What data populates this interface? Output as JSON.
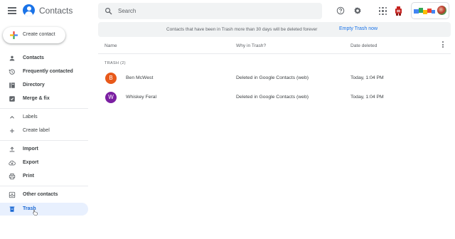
{
  "header": {
    "app_title": "Contacts",
    "search_placeholder": "Search",
    "icons": [
      "menu-icon",
      "contacts-logo-icon",
      "search-icon",
      "help-icon",
      "settings-icon",
      "apps-icon",
      "account-avatar"
    ]
  },
  "sidebar": {
    "create_label": "Create contact",
    "items": [
      {
        "label": "Contacts",
        "icon": "person-icon"
      },
      {
        "label": "Frequently contacted",
        "icon": "history-icon"
      },
      {
        "label": "Directory",
        "icon": "directory-icon"
      },
      {
        "label": "Merge & fix",
        "icon": "merge-icon"
      },
      {
        "label": "Labels",
        "icon": "chevron-up-icon"
      },
      {
        "label": "Create label",
        "icon": "plus-icon"
      },
      {
        "label": "Import",
        "icon": "upload-icon"
      },
      {
        "label": "Export",
        "icon": "cloud-download-icon"
      },
      {
        "label": "Print",
        "icon": "print-icon"
      },
      {
        "label": "Other contacts",
        "icon": "inbox-icon"
      },
      {
        "label": "Trash",
        "icon": "trash-icon",
        "active": true
      }
    ]
  },
  "banner": {
    "message": "Contacts that have been in Trash more than 30 days will be deleted forever",
    "action": "Empty Trash now"
  },
  "table": {
    "headers": [
      "Name",
      "Why in Trash?",
      "Date deleted"
    ],
    "section_label": "TRASH (2)",
    "rows": [
      {
        "initial": "B",
        "name": "Ben McWest",
        "why": "Deleted in Google Contacts (web)",
        "date": "Today, 1:04 PM",
        "color": "#e8591a"
      },
      {
        "initial": "W",
        "name": "Whiskey Feral",
        "why": "Deleted in Google Contacts (web)",
        "date": "Today, 1:04 PM",
        "color": "#7b1fa2"
      }
    ]
  },
  "colors": {
    "accent": "#1a73e8",
    "active_bg": "#e8f0fe"
  }
}
